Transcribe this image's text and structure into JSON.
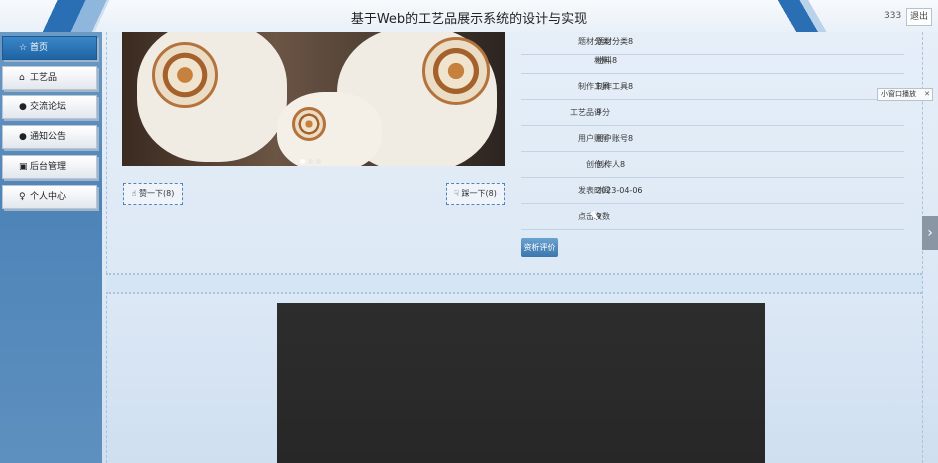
{
  "header": {
    "title": "基于Web的工艺品展示系统的设计与实现",
    "user": "333",
    "logout_label": "退出"
  },
  "sidebar": {
    "items": [
      {
        "label": "首页",
        "icon": "star-icon",
        "glyph": "☆"
      },
      {
        "label": "工艺品",
        "icon": "bag-icon",
        "glyph": "⌂"
      },
      {
        "label": "交流论坛",
        "icon": "info-icon",
        "glyph": "●"
      },
      {
        "label": "通知公告",
        "icon": "info-icon",
        "glyph": "●"
      },
      {
        "label": "后台管理",
        "icon": "building-icon",
        "glyph": "▣"
      },
      {
        "label": "个人中心",
        "icon": "person-icon",
        "glyph": "♀"
      }
    ]
  },
  "nav": {
    "prev_label": "赞一下(8)",
    "next_label": "踩一下(8)"
  },
  "details": [
    {
      "key": "题材分类",
      "value": "题材分类8"
    },
    {
      "key": "材料",
      "value": "材料8"
    },
    {
      "key": "制作工具",
      "value": "制作工具8"
    },
    {
      "key": "工艺品评分",
      "value": "8"
    },
    {
      "key": "用户账号",
      "value": "用户账号8"
    },
    {
      "key": "创作人",
      "value": "创作人8"
    },
    {
      "key": "发表时间",
      "value": "2023-04-06"
    },
    {
      "key": "点击次数",
      "value": "9"
    }
  ],
  "comment_button": "资析评价",
  "mini_window": {
    "label": "小窗口播放",
    "close": "✕"
  },
  "colors": {
    "accent": "#2a6fb3",
    "sidebar": "#5e90bf",
    "video": "#2b2b2b"
  }
}
